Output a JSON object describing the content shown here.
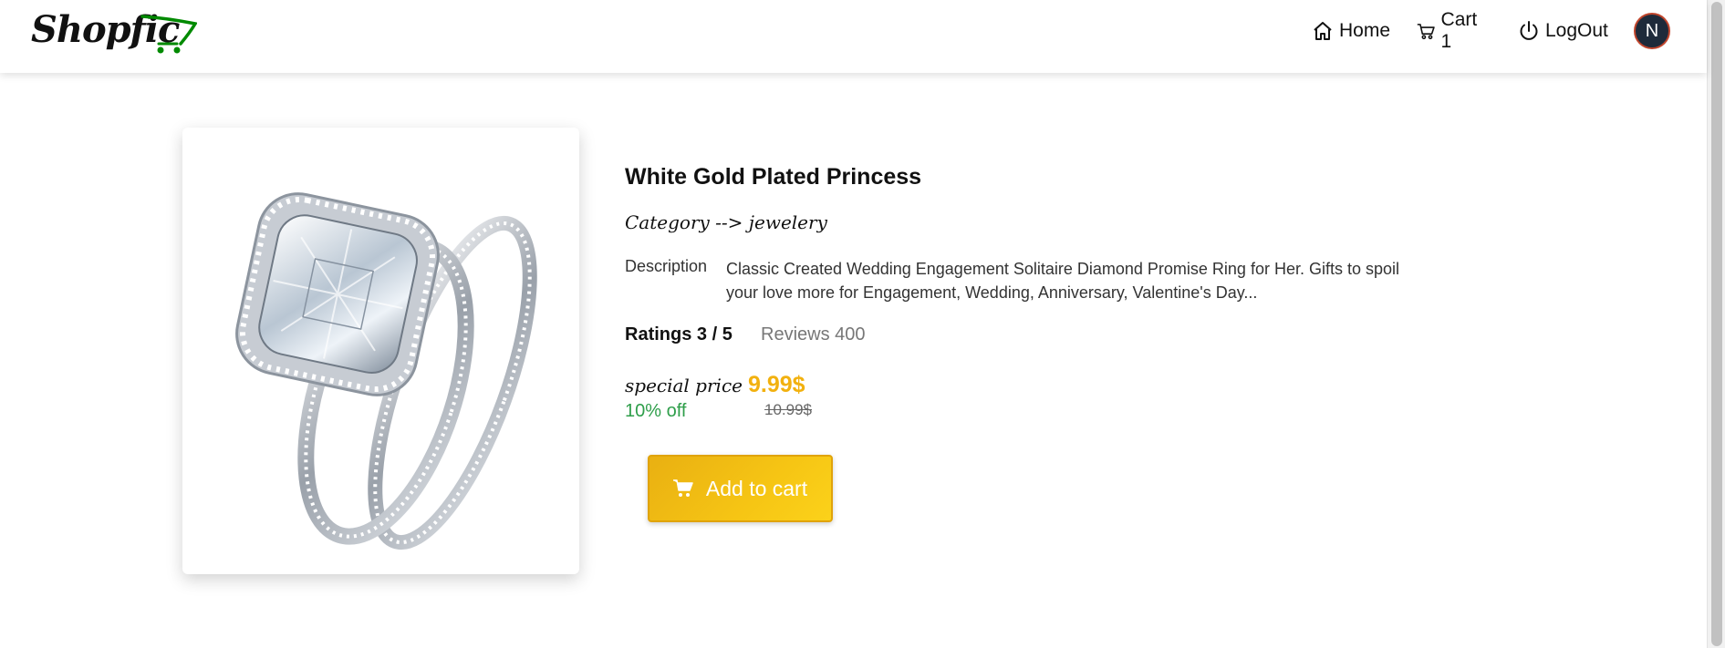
{
  "header": {
    "logo_text": "Shopfic",
    "brand_color": "#008a00",
    "nav": [
      {
        "label": "Home",
        "icon": "home-icon"
      },
      {
        "label": "Cart 1",
        "icon": "cart-icon"
      },
      {
        "label": "LogOut",
        "icon": "power-icon"
      }
    ],
    "avatar_initial": "N"
  },
  "product": {
    "title": "White Gold Plated Princess",
    "category": "Category --> jewelery",
    "description_label": "Description",
    "description": "Classic Created Wedding Engagement Solitaire Diamond Promise Ring for Her. Gifts to spoil your love more for Engagement, Wedding, Anniversary, Valentine's Day...",
    "ratings": "Ratings 3 / 5",
    "reviews": "Reviews 400",
    "special_price_label": "special price",
    "special_price": "9.99$",
    "discount": "10% off",
    "original_price": "10.99$",
    "add_to_cart_label": "Add to cart",
    "image_subject": "ring-image"
  },
  "colors": {
    "price": "#f2b10f",
    "discount": "#2e9e4a",
    "button": "#f6c514"
  }
}
